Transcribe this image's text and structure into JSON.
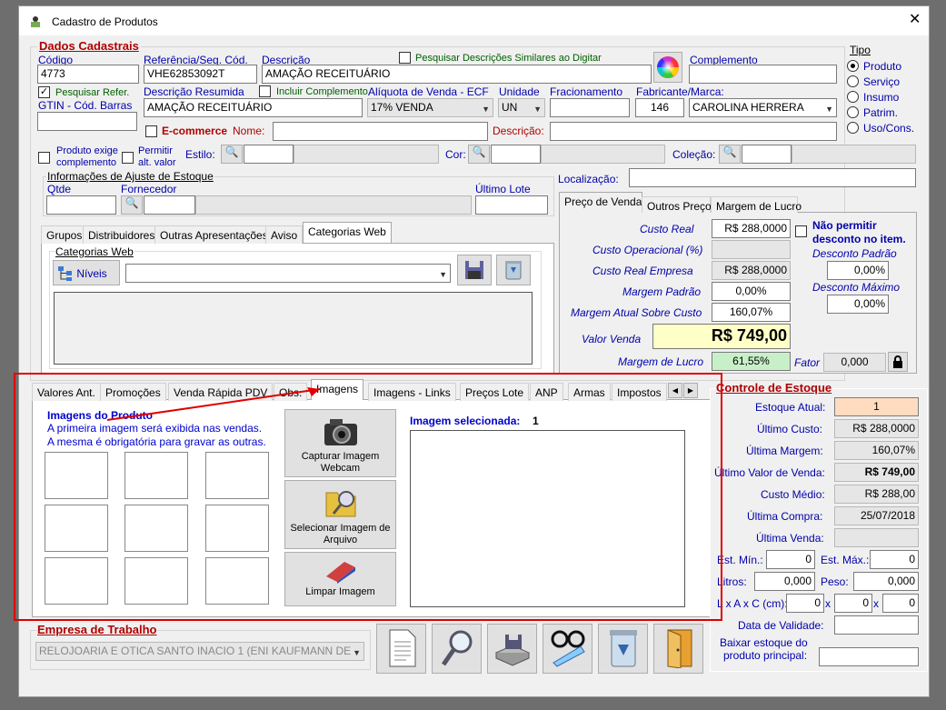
{
  "window": {
    "title": "Cadastro de Produtos",
    "close": "✕"
  },
  "dados": {
    "title": "Dados Cadastrais",
    "codigo_label": "Código",
    "codigo": "4773",
    "ref_label": "Referência/Seg. Cód.",
    "ref": "VHE62853092T",
    "desc_label": "Descrição",
    "desc": "AMAÇÃO RECEITUÁRIO",
    "pesq_similares": "Pesquisar Descrições Similares ao Digitar",
    "complemento_label": "Complemento",
    "complemento": "",
    "pesq_refer": "Pesquisar Refer.",
    "gtin_label": "GTIN - Cód. Barras",
    "gtin": "",
    "desc_res_label": "Descrição Resumida",
    "incluir_compl": "Incluir Complemento",
    "desc_res": "AMAÇÃO RECEITUÁRIO",
    "aliquota_label": "Alíquota de Venda - ECF",
    "aliquota": "17% VENDA",
    "unidade_label": "Unidade",
    "unidade": "UN",
    "fracionamento_label": "Fracionamento",
    "fracionamento": "",
    "fabricante_label": "Fabricante/Marca:",
    "fabricante_cod": "146",
    "fabricante": "CAROLINA HERRERA",
    "ecommerce": "E-commerce",
    "nome_label": "Nome:",
    "nome": "",
    "desc2_label": "Descrição:",
    "desc2": "",
    "prod_exige": "Produto exige",
    "complemento2": "complemento",
    "permitir": "Permitir",
    "alt_valor": "alt. valor",
    "estilo": "Estilo:",
    "cor": "Cor:",
    "colecao": "Coleção:"
  },
  "tipo": {
    "title": "Tipo",
    "options": [
      "Produto",
      "Serviço",
      "Insumo",
      "Patrim.",
      "Uso/Cons."
    ]
  },
  "ajuste": {
    "title": "Informações de Ajuste de Estoque",
    "qtde": "Qtde",
    "fornecedor": "Fornecedor",
    "ultimo_lote": "Último Lote"
  },
  "localizacao": {
    "label": "Localização:",
    "value": ""
  },
  "preco_tabs": [
    "Preço de Venda",
    "Outros Preços",
    "Margem de Lucro"
  ],
  "preco": {
    "custo_real_label": "Custo Real",
    "custo_real": "R$ 288,0000",
    "custo_op_label": "Custo Operacional (%)",
    "custo_op": "",
    "custo_emp_label": "Custo Real Empresa",
    "custo_emp": "R$ 288,0000",
    "margem_padrao_label": "Margem Padrão",
    "margem_padrao": "0,00%",
    "margem_atual_label": "Margem Atual Sobre Custo",
    "margem_atual": "160,07%",
    "valor_venda_label": "Valor Venda",
    "valor_venda": "R$ 749,00",
    "margem_lucro_label": "Margem de Lucro",
    "margem_lucro": "61,55%",
    "nao_permitir1": "Não permitir",
    "nao_permitir2": "desconto no item.",
    "desc_padrao_label": "Desconto Padrão",
    "desc_padrao": "0,00%",
    "desc_max_label": "Desconto Máximo",
    "desc_max": "0,00%",
    "fator_label": "Fator",
    "fator": "0,000"
  },
  "upper_tabs": [
    "Grupos",
    "Distribuidores",
    "Outras Apresentações",
    "Aviso",
    "Categorias Web"
  ],
  "catweb": {
    "title": "Categorias Web",
    "niveis": "Níveis"
  },
  "lower_tabs": [
    "Valores Ant.",
    "Promoções",
    "Venda Rápida PDV",
    "Obs.",
    "Imagens",
    "Imagens - Links",
    "Preços Lote",
    "ANP",
    "Armas",
    "Impostos"
  ],
  "imagens": {
    "title": "Imagens do Produto",
    "line1": "A primeira imagem será exibida nas vendas.",
    "line2": "A mesma é obrigatória para gravar as outras.",
    "capturar": "Capturar Imagem Webcam",
    "selecionar": "Selecionar Imagem de Arquivo",
    "limpar": "Limpar Imagem",
    "selecionada_label": "Imagem selecionada:",
    "selecionada": "1"
  },
  "estoque": {
    "title": "Controle de Estoque",
    "atual_label": "Estoque Atual:",
    "atual": "1",
    "ult_custo_label": "Último Custo:",
    "ult_custo": "R$ 288,0000",
    "ult_margem_label": "Última Margem:",
    "ult_margem": "160,07%",
    "ult_valor_label": "Último Valor de Venda:",
    "ult_valor": "R$ 749,00",
    "custo_medio_label": "Custo Médio:",
    "custo_medio": "R$ 288,00",
    "ult_compra_label": "Última Compra:",
    "ult_compra": "25/07/2018",
    "ult_venda_label": "Última Venda:",
    "ult_venda": "",
    "min_label": "Est. Mín.:",
    "min": "0",
    "max_label": "Est. Máx.:",
    "max": "0",
    "litros_label": "Litros:",
    "litros": "0,000",
    "peso_label": "Peso:",
    "peso": "0,000",
    "dim_label": "L x A x C (cm):",
    "l": "0",
    "a": "0",
    "c": "0",
    "x": "x",
    "validade_label": "Data de Validade:",
    "validade": "",
    "baixar1": "Baixar estoque do",
    "baixar2": "produto principal:",
    "baixar": ""
  },
  "empresa": {
    "title": "Empresa de Trabalho",
    "value": "RELOJOARIA E OTICA SANTO INACIO 1  (ENI KAUFMANN DE"
  },
  "colors": {
    "red": "#b00000",
    "blue": "#0000aa",
    "highlight": "#e00000"
  }
}
